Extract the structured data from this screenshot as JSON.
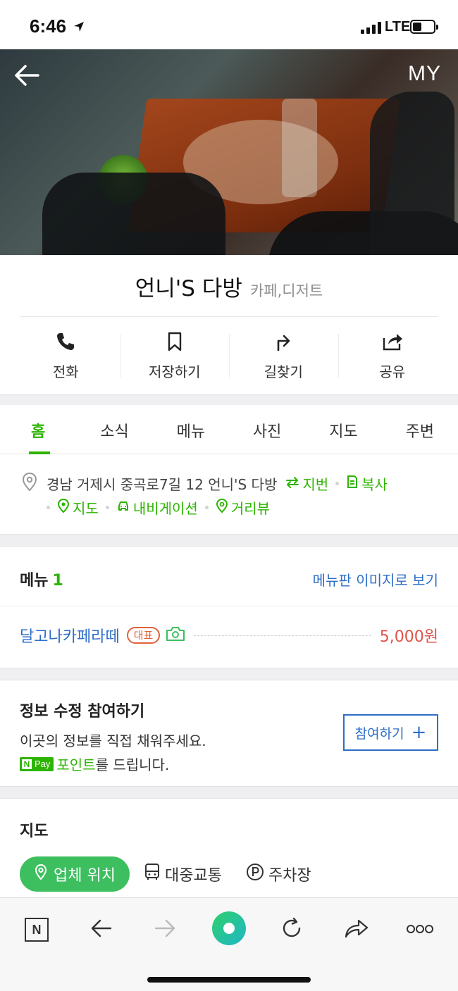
{
  "status_bar": {
    "time": "6:46",
    "network": "LTE"
  },
  "hero": {
    "my_label": "MY"
  },
  "place": {
    "name": "언니'S 다방",
    "category": "카페,디저트"
  },
  "actions": [
    {
      "label": "전화",
      "icon": "phone-icon"
    },
    {
      "label": "저장하기",
      "icon": "bookmark-icon"
    },
    {
      "label": "길찾기",
      "icon": "directions-icon"
    },
    {
      "label": "공유",
      "icon": "share-icon"
    }
  ],
  "tabs": [
    "홈",
    "소식",
    "메뉴",
    "사진",
    "지도",
    "주변"
  ],
  "active_tab": "홈",
  "address": {
    "text": "경남 거제시 중곡로7길 12 언니'S 다방",
    "jibun": "지번",
    "copy": "복사",
    "map": "지도",
    "navigation": "내비게이션",
    "street_view": "거리뷰"
  },
  "menu": {
    "title": "메뉴",
    "count": "1",
    "view_image": "메뉴판 이미지로 보기",
    "items": [
      {
        "name": "달고나카페라떼",
        "badge": "대표",
        "price": "5,000원"
      }
    ]
  },
  "edit": {
    "title": "정보 수정 참여하기",
    "desc1": "이곳의 정보를 직접 채워주세요.",
    "npay_n": "N",
    "npay_pay": "Pay",
    "points": "포인트",
    "desc2_rest": "를 드립니다.",
    "join_label": "참여하기",
    "join_plus": "+"
  },
  "map": {
    "title": "지도",
    "chips": [
      "업체 위치",
      "대중교통",
      "주차장"
    ]
  },
  "toolbar": {
    "naver_label": "N"
  },
  "colors": {
    "naver_green": "#2db400",
    "link_blue": "#2e6ec8",
    "price_red": "#e05348",
    "chip_green": "#3dbf5f"
  }
}
